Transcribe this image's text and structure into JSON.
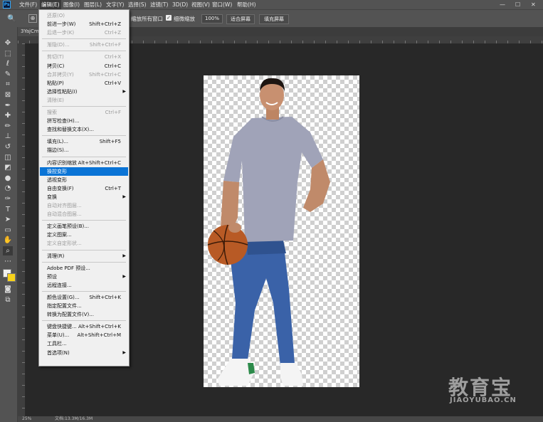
{
  "app": {
    "logo": "Ps"
  },
  "menubar": {
    "items": [
      "文件(F)",
      "编辑(E)",
      "图像(I)",
      "图层(L)",
      "文字(Y)",
      "选择(S)",
      "滤镜(T)",
      "3D(D)",
      "视图(V)",
      "窗口(W)",
      "帮助(H)"
    ],
    "window_controls": [
      "—",
      "☐",
      "✕"
    ]
  },
  "options": {
    "zoom_symbol": "🔍",
    "zoom_mode": "⊕",
    "resize_all": "缩放所有窗口",
    "scrubby_zoom": "细微缩放",
    "scrubby_checked": true,
    "zoom_value": "100%",
    "fit_screen": "适合屏幕",
    "fill_screen": "填充屏幕"
  },
  "document": {
    "tab_title": "3YajCm..."
  },
  "status": {
    "zoom": "25%",
    "doc_info": "文档:13.3M/16.3M"
  },
  "edit_menu": {
    "groups": [
      [
        {
          "label": "还原(O)",
          "shortcut": "",
          "disabled": true
        },
        {
          "label": "前进一步(W)",
          "shortcut": "Shift+Ctrl+Z"
        },
        {
          "label": "后退一步(K)",
          "shortcut": "Ctrl+Z",
          "disabled": true
        }
      ],
      [
        {
          "label": "渐隐(D)...",
          "shortcut": "Shift+Ctrl+F",
          "disabled": true
        }
      ],
      [
        {
          "label": "剪切(T)",
          "shortcut": "Ctrl+X",
          "disabled": true
        },
        {
          "label": "拷贝(C)",
          "shortcut": "Ctrl+C"
        },
        {
          "label": "合并拷贝(Y)",
          "shortcut": "Shift+Ctrl+C",
          "disabled": true
        },
        {
          "label": "粘贴(P)",
          "shortcut": "Ctrl+V"
        },
        {
          "label": "选择性粘贴(I)",
          "shortcut": "",
          "submenu": true
        },
        {
          "label": "清除(E)",
          "shortcut": "",
          "disabled": true
        }
      ],
      [
        {
          "label": "搜索",
          "shortcut": "Ctrl+F",
          "disabled": true
        },
        {
          "label": "拼写检查(H)...",
          "shortcut": ""
        },
        {
          "label": "查找和替换文本(X)...",
          "shortcut": ""
        }
      ],
      [
        {
          "label": "填充(L)...",
          "shortcut": "Shift+F5"
        },
        {
          "label": "描边(S)...",
          "shortcut": ""
        }
      ],
      [
        {
          "label": "内容识别缩放",
          "shortcut": "Alt+Shift+Ctrl+C"
        },
        {
          "label": "操控变形",
          "shortcut": "",
          "highlighted": true
        },
        {
          "label": "透视变形",
          "shortcut": ""
        },
        {
          "label": "自由变换(F)",
          "shortcut": "Ctrl+T"
        },
        {
          "label": "变换",
          "shortcut": "",
          "submenu": true
        },
        {
          "label": "自动对齐图层...",
          "shortcut": "",
          "disabled": true
        },
        {
          "label": "自动混合图层...",
          "shortcut": "",
          "disabled": true
        }
      ],
      [
        {
          "label": "定义画笔预设(B)...",
          "shortcut": ""
        },
        {
          "label": "定义图案...",
          "shortcut": ""
        },
        {
          "label": "定义自定形状...",
          "shortcut": "",
          "disabled": true
        }
      ],
      [
        {
          "label": "清理(R)",
          "shortcut": "",
          "submenu": true
        }
      ],
      [
        {
          "label": "Adobe PDF 预设...",
          "shortcut": ""
        },
        {
          "label": "预设",
          "shortcut": "",
          "submenu": true
        },
        {
          "label": "远程连接...",
          "shortcut": ""
        }
      ],
      [
        {
          "label": "颜色设置(G)...",
          "shortcut": "Shift+Ctrl+K"
        },
        {
          "label": "指定配置文件...",
          "shortcut": ""
        },
        {
          "label": "转换为配置文件(V)...",
          "shortcut": ""
        }
      ],
      [
        {
          "label": "键盘快捷键...",
          "shortcut": "Alt+Shift+Ctrl+K"
        },
        {
          "label": "菜单(U)...",
          "shortcut": "Alt+Shift+Ctrl+M"
        },
        {
          "label": "工具栏...",
          "shortcut": ""
        },
        {
          "label": "首选项(N)",
          "shortcut": "",
          "submenu": true
        }
      ]
    ]
  },
  "tools": [
    {
      "name": "move-tool",
      "glyph": "✥"
    },
    {
      "name": "marquee-tool",
      "glyph": "⬚"
    },
    {
      "name": "lasso-tool",
      "glyph": "ℓ"
    },
    {
      "name": "quick-select-tool",
      "glyph": "✎"
    },
    {
      "name": "crop-tool",
      "glyph": "⌗"
    },
    {
      "name": "frame-tool",
      "glyph": "⊠"
    },
    {
      "name": "eyedropper-tool",
      "glyph": "✒"
    },
    {
      "name": "healing-tool",
      "glyph": "✚"
    },
    {
      "name": "brush-tool",
      "glyph": "✏"
    },
    {
      "name": "stamp-tool",
      "glyph": "⊥"
    },
    {
      "name": "history-brush-tool",
      "glyph": "↺"
    },
    {
      "name": "eraser-tool",
      "glyph": "◫"
    },
    {
      "name": "paint-bucket-tool",
      "glyph": "◩"
    },
    {
      "name": "blur-tool",
      "glyph": "●"
    },
    {
      "name": "dodge-tool",
      "glyph": "◔"
    },
    {
      "name": "pen-tool",
      "glyph": "✑"
    },
    {
      "name": "type-tool",
      "glyph": "T"
    },
    {
      "name": "path-select-tool",
      "glyph": "➤"
    },
    {
      "name": "shape-tool",
      "glyph": "▭"
    },
    {
      "name": "hand-tool",
      "glyph": "✋"
    },
    {
      "name": "zoom-tool",
      "glyph": "⌕",
      "selected": true
    },
    {
      "name": "more-tools",
      "glyph": "⋯"
    }
  ],
  "extra_tools": [
    {
      "name": "quick-mask-icon",
      "glyph": "◙"
    },
    {
      "name": "screen-mode-icon",
      "glyph": "⧉"
    }
  ],
  "watermark": {
    "big": "教育宝",
    "small": "JIAOYUBAO.CN"
  }
}
